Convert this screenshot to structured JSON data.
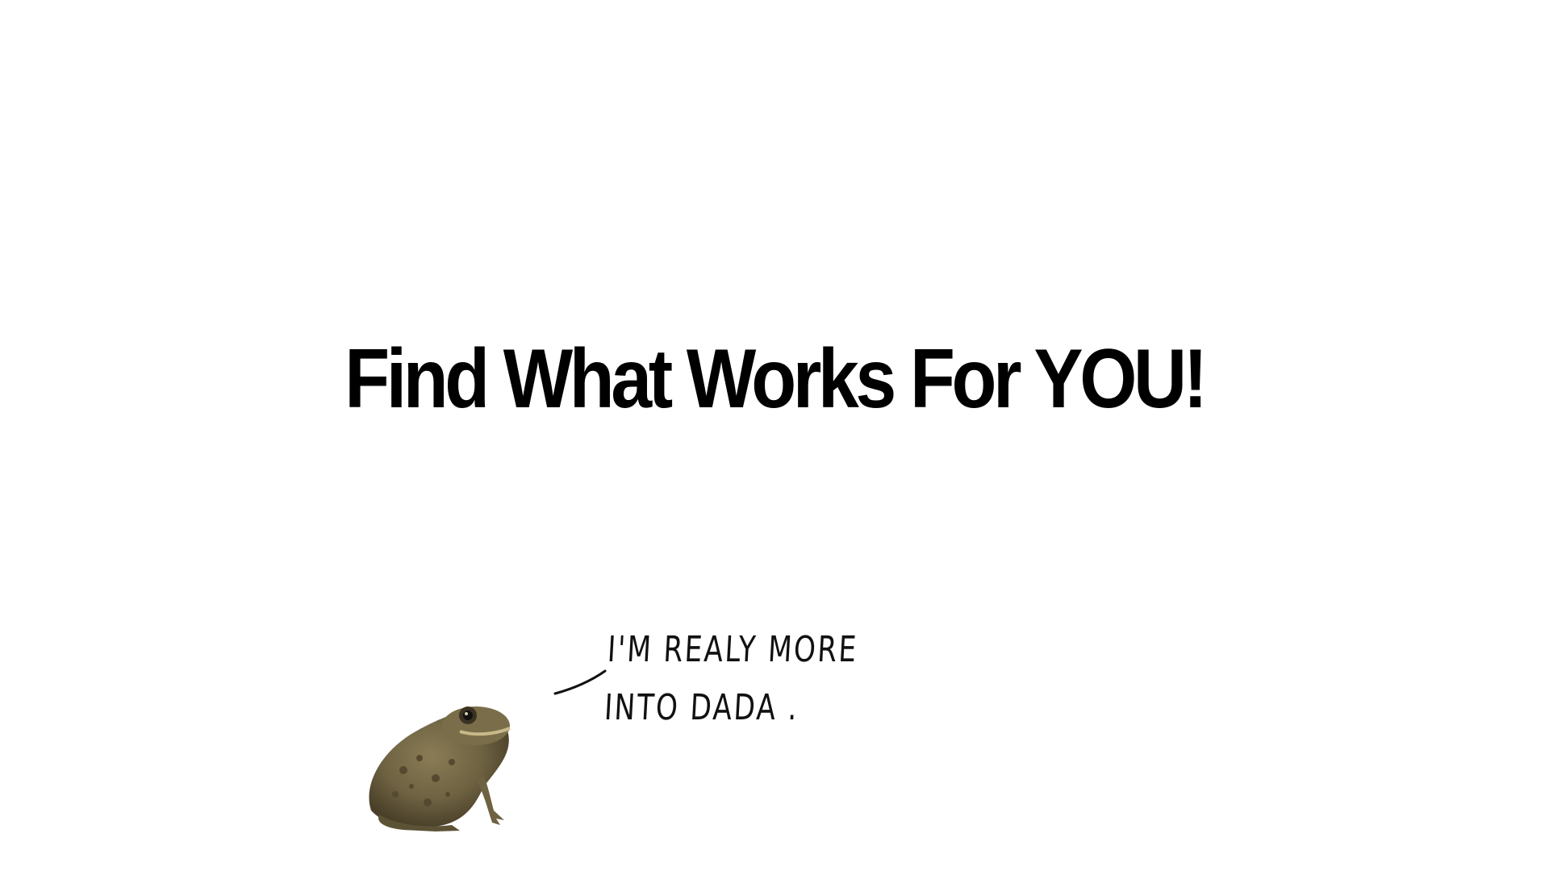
{
  "slide": {
    "title": "Find What Works For YOU!",
    "speech_bubble": {
      "line1": "I'M REALY MORE",
      "line2": "INTO  DADA ."
    },
    "image": {
      "subject": "toad-icon"
    }
  },
  "colors": {
    "background": "#ffffff",
    "text": "#000000",
    "toad_body": "#6e6242",
    "toad_dark": "#4a4029"
  }
}
